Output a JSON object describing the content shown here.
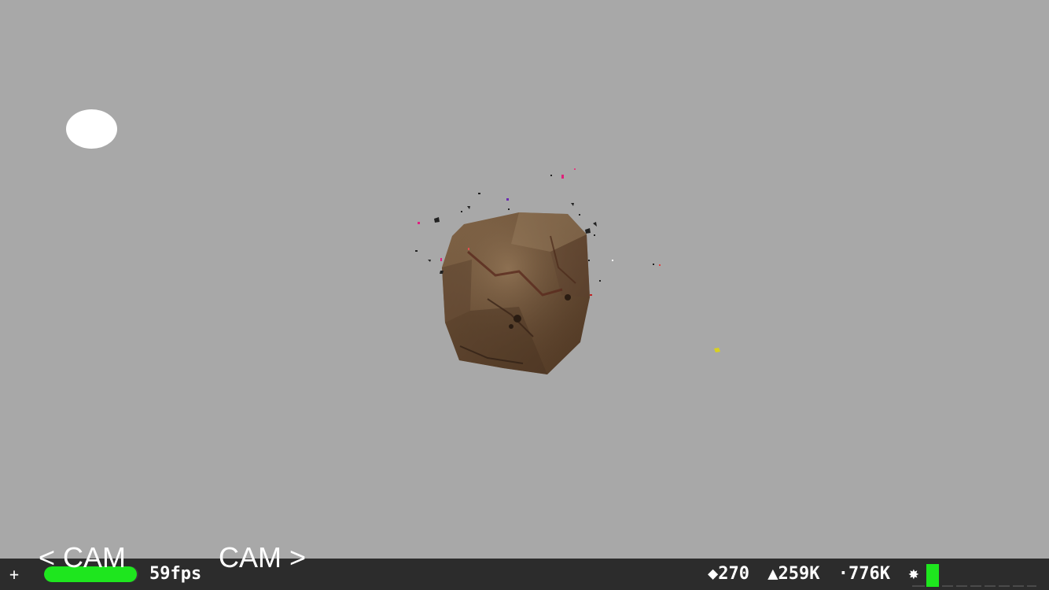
{
  "hud": {
    "cam_prev_label": "< CAM",
    "cam_next_label": "CAM >"
  },
  "stats_bar": {
    "add_label": "+",
    "fps_text": "59fps",
    "fps_fill_fraction": 0.98,
    "draw_calls": "◆270",
    "triangles": "▲259K",
    "points": "·776K",
    "lights": "✸",
    "colors": {
      "background": "#2c2c2c",
      "fps_bar": "#1ee61e",
      "text": "#ffffff"
    }
  },
  "scene": {
    "background_color": "#a8a8a8",
    "objects": [
      "light-source",
      "rock",
      "particle-debris"
    ]
  }
}
